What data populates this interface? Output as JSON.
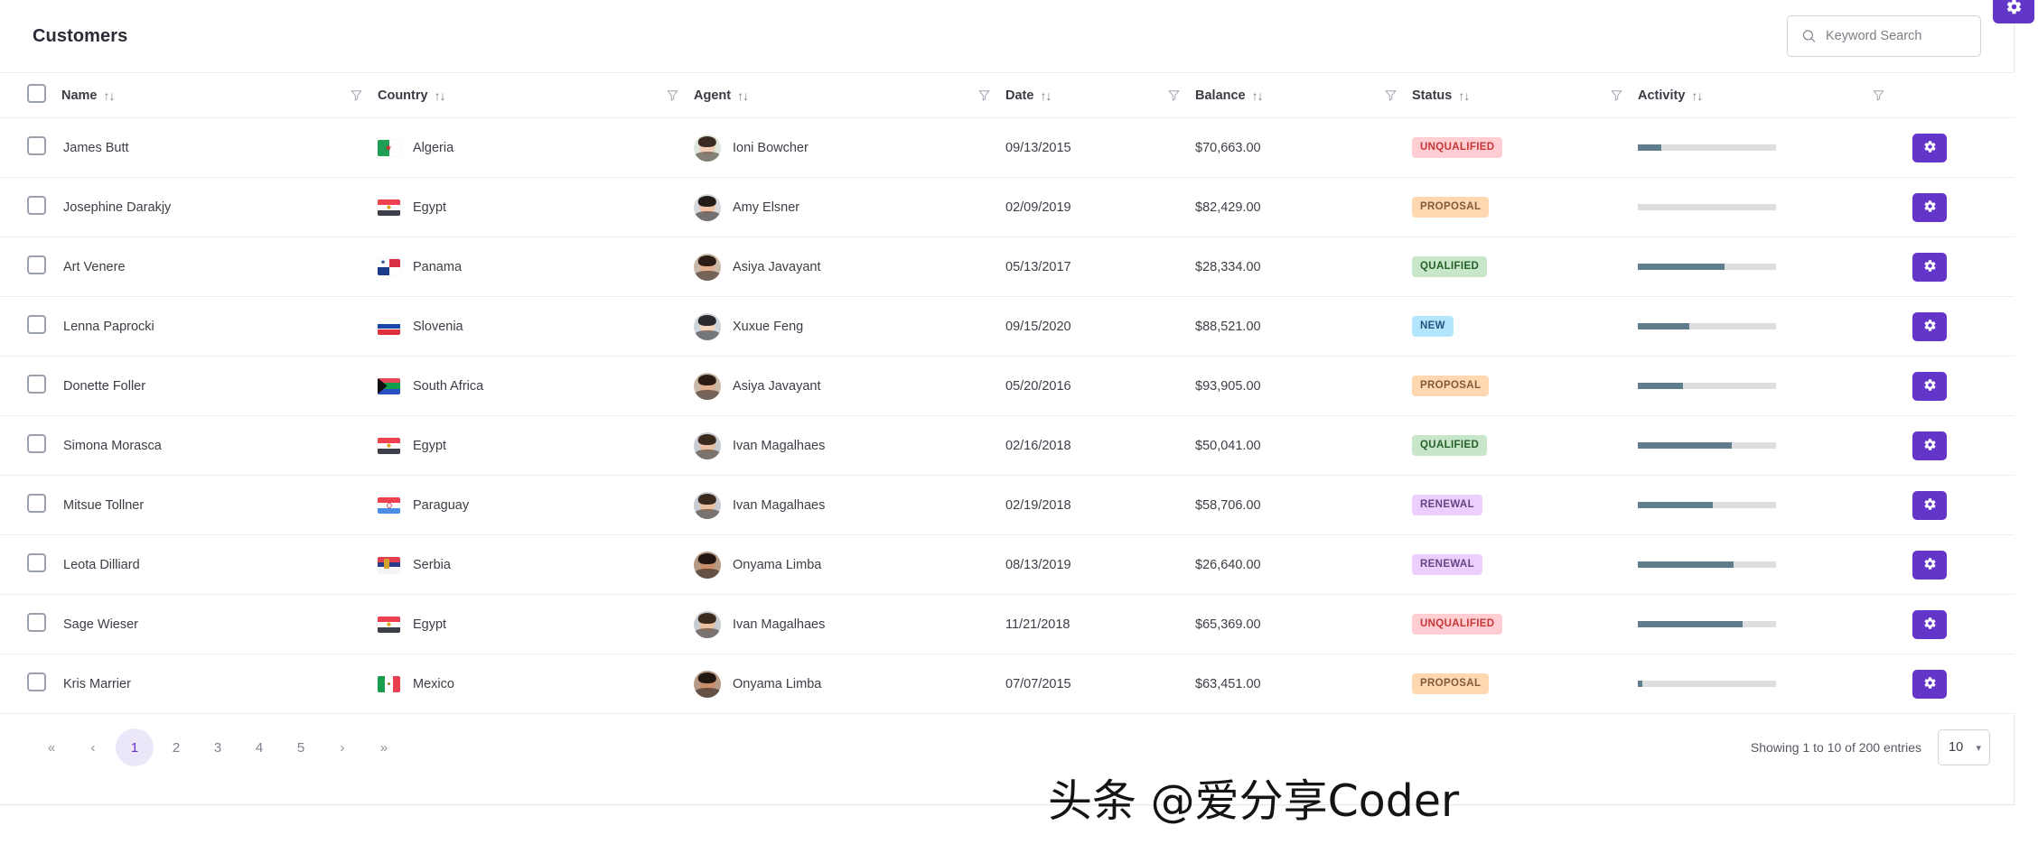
{
  "header": {
    "title": "Customers",
    "search": {
      "value": "",
      "placeholder": "Keyword Search",
      "icon": "search-icon"
    }
  },
  "corner_button": {
    "icon": "gear-icon",
    "color": "#6435c9"
  },
  "table": {
    "columns": [
      {
        "key": "check",
        "label": "",
        "sortable": false,
        "filterable": false
      },
      {
        "key": "name",
        "label": "Name",
        "sortable": true,
        "filterable": true
      },
      {
        "key": "country",
        "label": "Country",
        "sortable": true,
        "filterable": true
      },
      {
        "key": "agent",
        "label": "Agent",
        "sortable": true,
        "filterable": true
      },
      {
        "key": "date",
        "label": "Date",
        "sortable": true,
        "filterable": true
      },
      {
        "key": "balance",
        "label": "Balance",
        "sortable": true,
        "filterable": true
      },
      {
        "key": "status",
        "label": "Status",
        "sortable": true,
        "filterable": true
      },
      {
        "key": "activity",
        "label": "Activity",
        "sortable": true,
        "filterable": true
      },
      {
        "key": "action",
        "label": "",
        "sortable": false,
        "filterable": false
      }
    ],
    "sort_icon": "↑↓",
    "filter_icon": "funnel-icon",
    "row_action_icon": "gear-icon",
    "rows": [
      {
        "name": "James Butt",
        "country": "Algeria",
        "agent": "Ioni Bowcher",
        "date": "09/13/2015",
        "balance": "$70,663.00",
        "status": "UNQUALIFIED",
        "activity": 17
      },
      {
        "name": "Josephine Darakjy",
        "country": "Egypt",
        "agent": "Amy Elsner",
        "date": "02/09/2019",
        "balance": "$82,429.00",
        "status": "PROPOSAL",
        "activity": 0
      },
      {
        "name": "Art Venere",
        "country": "Panama",
        "agent": "Asiya Javayant",
        "date": "05/13/2017",
        "balance": "$28,334.00",
        "status": "QUALIFIED",
        "activity": 63
      },
      {
        "name": "Lenna Paprocki",
        "country": "Slovenia",
        "agent": "Xuxue Feng",
        "date": "09/15/2020",
        "balance": "$88,521.00",
        "status": "NEW",
        "activity": 37
      },
      {
        "name": "Donette Foller",
        "country": "South Africa",
        "agent": "Asiya Javayant",
        "date": "05/20/2016",
        "balance": "$93,905.00",
        "status": "PROPOSAL",
        "activity": 33
      },
      {
        "name": "Simona Morasca",
        "country": "Egypt",
        "agent": "Ivan Magalhaes",
        "date": "02/16/2018",
        "balance": "$50,041.00",
        "status": "QUALIFIED",
        "activity": 68
      },
      {
        "name": "Mitsue Tollner",
        "country": "Paraguay",
        "agent": "Ivan Magalhaes",
        "date": "02/19/2018",
        "balance": "$58,706.00",
        "status": "RENEWAL",
        "activity": 54
      },
      {
        "name": "Leota Dilliard",
        "country": "Serbia",
        "agent": "Onyama Limba",
        "date": "08/13/2019",
        "balance": "$26,640.00",
        "status": "RENEWAL",
        "activity": 69
      },
      {
        "name": "Sage Wieser",
        "country": "Egypt",
        "agent": "Ivan Magalhaes",
        "date": "11/21/2018",
        "balance": "$65,369.00",
        "status": "UNQUALIFIED",
        "activity": 76
      },
      {
        "name": "Kris Marrier",
        "country": "Mexico",
        "agent": "Onyama Limba",
        "date": "07/07/2015",
        "balance": "$63,451.00",
        "status": "PROPOSAL",
        "activity": 3
      }
    ]
  },
  "status_colors": {
    "UNQUALIFIED": {
      "bg": "#ffcdd2",
      "fg": "#c63737"
    },
    "PROPOSAL": {
      "bg": "#ffd8b2",
      "fg": "#805b36"
    },
    "QUALIFIED": {
      "bg": "#c8e6c9",
      "fg": "#256029"
    },
    "NEW": {
      "bg": "#b3e5fc",
      "fg": "#23547b"
    },
    "RENEWAL": {
      "bg": "#eccfff",
      "fg": "#694382"
    }
  },
  "activity_bar": {
    "fill": "#607d8b",
    "track": "#dcdee0"
  },
  "pagination": {
    "first_label": "«",
    "prev_label": "‹",
    "pages": [
      "1",
      "2",
      "3",
      "4",
      "5"
    ],
    "active_page": "1",
    "next_label": "›",
    "last_label": "»",
    "active_color": "#6435c9"
  },
  "footer": {
    "showing": "Showing 1 to 10 of 200 entries",
    "rows_per_page": "10",
    "caret_icon": "chevron-down-icon"
  },
  "watermark": {
    "text": "头条 @爱分享Coder"
  }
}
